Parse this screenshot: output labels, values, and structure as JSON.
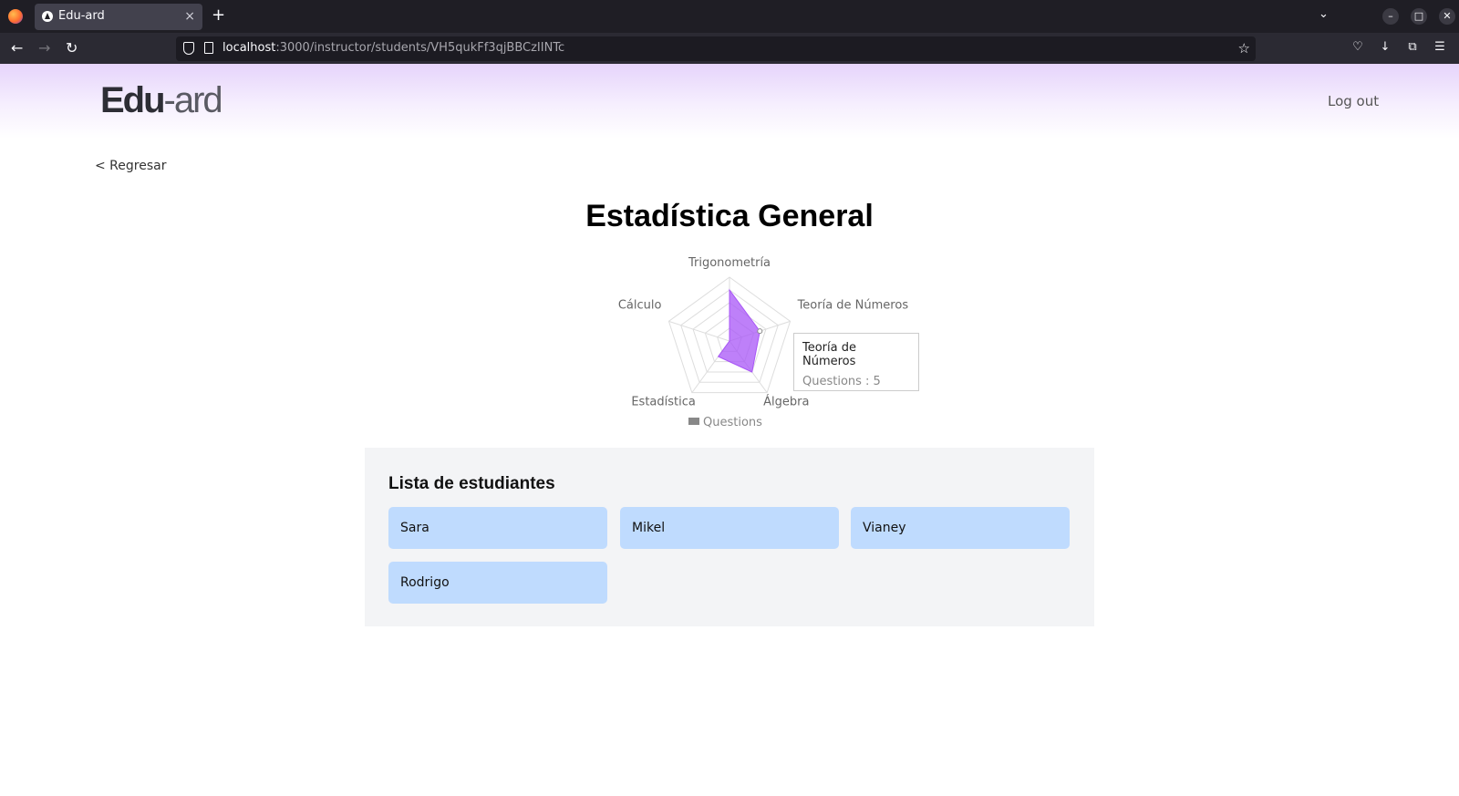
{
  "browser": {
    "tab_title": "Edu-ard",
    "tab_close": "×",
    "new_tab": "+",
    "url_host": "localhost",
    "url_path": ":3000/instructor/students/VH5qukFf3qjBBCzIINTc"
  },
  "header": {
    "logo_bold": "Edu",
    "logo_thin": "-ard",
    "logout_label": "Log out"
  },
  "back_label": "< Regresar",
  "page_title": "Estadística General",
  "chart_data": {
    "type": "radar",
    "categories": [
      "Trigonometría",
      "Teoría de Números",
      "Álgebra",
      "Estadística",
      "Cálculo"
    ],
    "series": [
      {
        "name": "Questions",
        "values": [
          8,
          5,
          6,
          3,
          0
        ]
      }
    ],
    "rlim": [
      0,
      10
    ],
    "grid": true,
    "legend_position": "bottom",
    "color": "#a855f7",
    "tooltip": {
      "title": "Teoría de Números",
      "text": "Questions : 5"
    }
  },
  "legend_label": "Questions",
  "students_section": {
    "title": "Lista de estudiantes",
    "students": [
      "Sara",
      "Mikel",
      "Vianey",
      "Rodrigo"
    ]
  }
}
